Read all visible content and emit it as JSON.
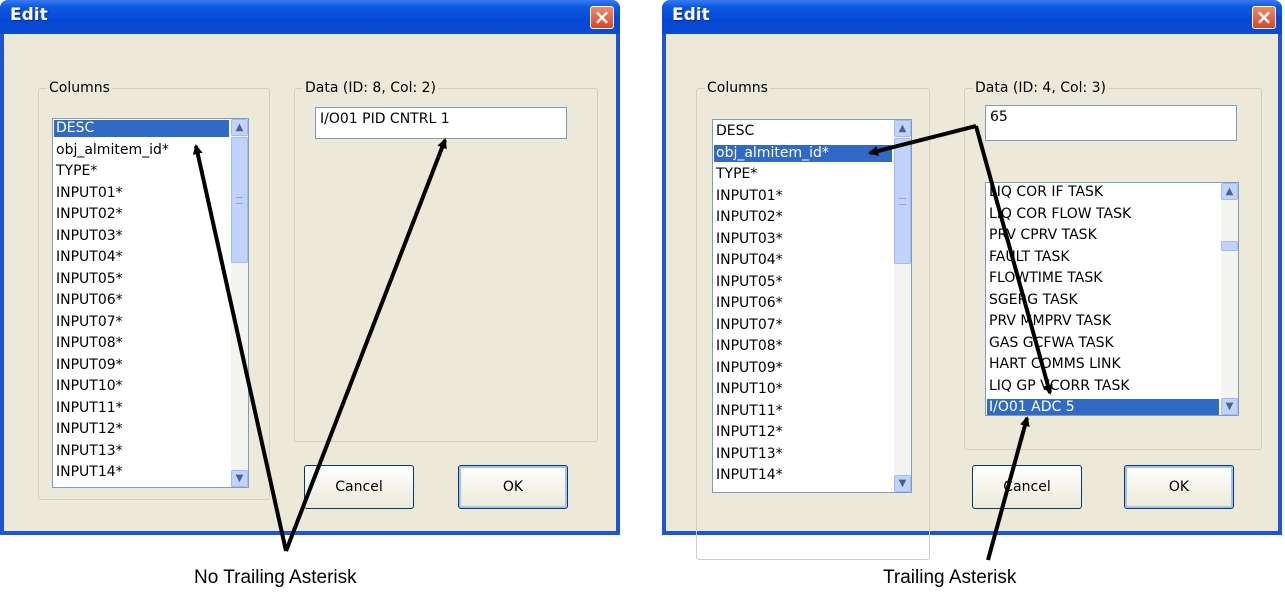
{
  "dialog1": {
    "title": "Edit",
    "close_label": "×",
    "columns_legend": "Columns",
    "data_legend": "Data (ID: 8, Col: 2)",
    "data_value": "I/O01 PID CNTRL 1",
    "columns": [
      "DESC",
      "obj_almitem_id*",
      "TYPE*",
      "INPUT01*",
      "INPUT02*",
      "INPUT03*",
      "INPUT04*",
      "INPUT05*",
      "INPUT06*",
      "INPUT07*",
      "INPUT08*",
      "INPUT09*",
      "INPUT10*",
      "INPUT11*",
      "INPUT12*",
      "INPUT13*",
      "INPUT14*"
    ],
    "selected_column": "DESC",
    "cancel_label": "Cancel",
    "ok_label": "OK"
  },
  "dialog2": {
    "title": "Edit",
    "close_label": "×",
    "columns_legend": "Columns",
    "data_legend": "Data (ID: 4, Col: 3)",
    "data_value": "65",
    "columns": [
      "DESC",
      "obj_almitem_id*",
      "TYPE*",
      "INPUT01*",
      "INPUT02*",
      "INPUT03*",
      "INPUT04*",
      "INPUT05*",
      "INPUT06*",
      "INPUT07*",
      "INPUT08*",
      "INPUT09*",
      "INPUT10*",
      "INPUT11*",
      "INPUT12*",
      "INPUT13*",
      "INPUT14*"
    ],
    "selected_column": "obj_almitem_id*",
    "options": [
      "LIQ COR IF TASK",
      "LIQ COR FLOW TASK",
      "PRV CPRV TASK",
      "FAULT TASK",
      "FLOWTIME TASK",
      "SGERG TASK",
      "PRV MMPRV TASK",
      "GAS GCFWA TASK",
      "HART COMMS LINK",
      "LIQ GP VCORR TASK",
      "I/O01 ADC 5"
    ],
    "selected_option": "I/O01 ADC 5",
    "cancel_label": "Cancel",
    "ok_label": "OK"
  },
  "captions": {
    "left": "No Trailing Asterisk",
    "right": "Trailing Asterisk"
  },
  "colors": {
    "titlebar": "#0548d6",
    "selection": "#316ac5",
    "dialog_face": "#ece9d8",
    "close_button": "#d8452a"
  },
  "icons": {
    "close": "close-icon",
    "scroll_up": "scroll-up-arrow-icon",
    "scroll_down": "scroll-down-arrow-icon"
  }
}
